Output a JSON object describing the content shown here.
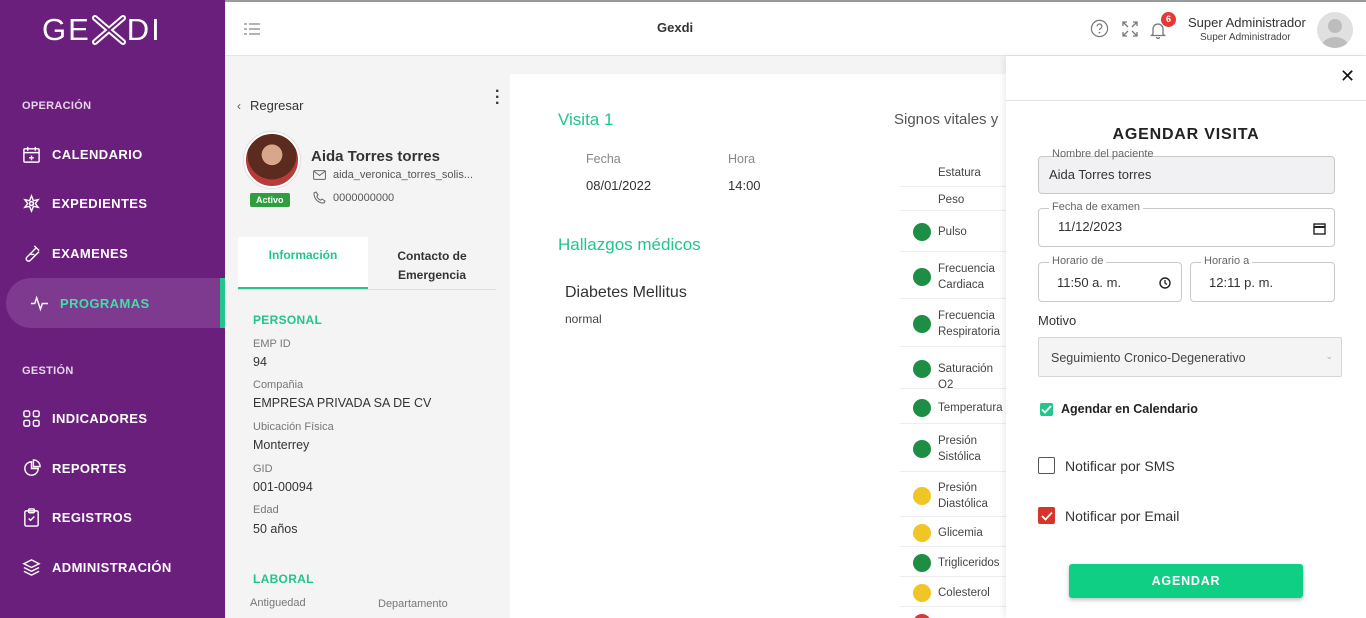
{
  "sidebar": {
    "logo": "GEXDI",
    "sections": [
      {
        "title": "OPERACIÓN"
      },
      {
        "title": "GESTIÓN"
      }
    ],
    "items": [
      {
        "label": "CALENDARIO",
        "icon": "calendar-plus-icon"
      },
      {
        "label": "EXPEDIENTES",
        "icon": "medical-cross-icon"
      },
      {
        "label": "EXAMENES",
        "icon": "test-tube-icon"
      },
      {
        "label": "PROGRAMAS",
        "icon": "pulse-icon",
        "active": true
      },
      {
        "label": "INDICADORES",
        "icon": "grid-icon"
      },
      {
        "label": "REPORTES",
        "icon": "pie-chart-icon"
      },
      {
        "label": "REGISTROS",
        "icon": "clipboard-check-icon"
      },
      {
        "label": "ADMINISTRACIÓN",
        "icon": "layers-icon"
      }
    ]
  },
  "topbar": {
    "title": "Gexdi",
    "notifications": "6",
    "user_name": "Super Administrador",
    "user_role": "Super Administrador"
  },
  "patient": {
    "back_label": "Regresar",
    "name": "Aida Torres torres",
    "email": "aida_veronica_torres_solis...",
    "phone": "0000000000",
    "status": "Activo",
    "tabs": [
      "Información",
      "Contacto de Emergencia"
    ],
    "personal_title": "PERSONAL",
    "fields": [
      {
        "label": "EMP ID",
        "value": "94"
      },
      {
        "label": "Compañia",
        "value": "EMPRESA PRIVADA SA DE CV"
      },
      {
        "label": "Ubicación Física",
        "value": "Monterrey"
      },
      {
        "label": "GID",
        "value": "001-00094"
      },
      {
        "label": "Edad",
        "value": "50 años"
      }
    ],
    "laboral_title": "LABORAL",
    "laboral_labels": [
      "Antiguedad",
      "Departamento"
    ]
  },
  "visit": {
    "title": "Visita 1",
    "date_label": "Fecha",
    "date_value": "08/01/2022",
    "time_label": "Hora",
    "time_value": "14:00",
    "findings_title": "Hallazgos médicos",
    "diagnosis": "Diabetes Mellitus",
    "diagnosis_note": "normal",
    "vitals_title": "Signos vitales y",
    "vitals": [
      {
        "name": "Estatura",
        "status": "none"
      },
      {
        "name": "Peso",
        "status": "none"
      },
      {
        "name": "Pulso",
        "status": "green"
      },
      {
        "name": "Frecuencia Cardiaca",
        "status": "green"
      },
      {
        "name": "Frecuencia Respiratoria",
        "status": "green"
      },
      {
        "name": "Saturación O2",
        "status": "green"
      },
      {
        "name": "Temperatura",
        "status": "green"
      },
      {
        "name": "Presión Sistólica",
        "status": "green"
      },
      {
        "name": "Presión Diastólica",
        "status": "yellow"
      },
      {
        "name": "Glicemia",
        "status": "yellow"
      },
      {
        "name": "Trigliceridos",
        "status": "green"
      },
      {
        "name": "Colesterol",
        "status": "yellow"
      },
      {
        "name": "",
        "status": "red"
      }
    ],
    "status_colors": {
      "green": "#1e8e44",
      "yellow": "#f2c526",
      "red": "#d23b33"
    }
  },
  "modal": {
    "title": "AGENDAR VISITA",
    "patient_label": "Nombre del paciente",
    "patient_value": "Aida Torres torres",
    "date_label": "Fecha de examen",
    "date_value": "11/12/2023",
    "from_label": "Horario de",
    "from_value": "11:50 a. m.",
    "to_label": "Horario a",
    "to_value": "12:11 p. m.",
    "motivo_label": "Motivo",
    "motivo_value": "Seguimiento Cronico-Degenerativo",
    "calendar_label": "Agendar en Calendario",
    "sms_label": "Notificar por SMS",
    "email_label": "Notificar por Email",
    "submit_label": "AGENDAR"
  },
  "colors": {
    "brand": "#6b1f7c",
    "accent": "#22c58b",
    "submit": "#0fcf85"
  }
}
